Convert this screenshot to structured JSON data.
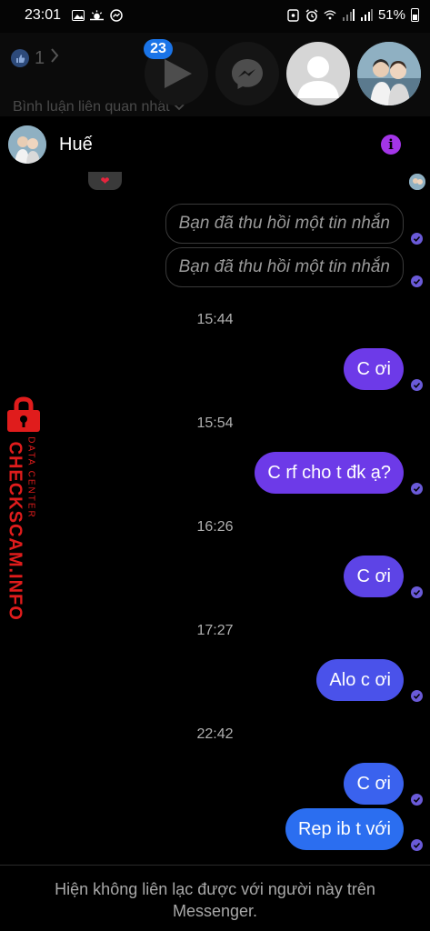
{
  "status_bar": {
    "time": "23:01",
    "battery": "51%",
    "icons": [
      "gallery-icon",
      "weather-icon",
      "messenger-icon",
      "lock-icon",
      "alarm-icon",
      "wifi-icon",
      "signal-icon",
      "signal-icon",
      "battery-icon"
    ]
  },
  "background": {
    "like_count": "1",
    "comments_label": "Bình luận liên quan nhất"
  },
  "chat_heads": {
    "badge": "23",
    "items": [
      "play-icon",
      "messenger-icon",
      "default-avatar",
      "contact-photo"
    ]
  },
  "chat": {
    "contact_name": "Huế",
    "reaction": "❤",
    "recalled": [
      "Bạn đã thu hồi một tin nhắn",
      "Bạn đã thu hồi một tin nhắn"
    ],
    "timestamps": [
      "15:44",
      "15:54",
      "16:26",
      "17:27",
      "22:42"
    ],
    "messages": [
      "C ơi",
      "C rf cho t đk ạ?",
      "C ơi",
      "Alo c ơi",
      "C ơi",
      "Rep ib t với"
    ],
    "footer": "Hiện không liên lạc được với người này trên Messenger."
  },
  "watermark": {
    "brand": "CHECKSCAM.INFO",
    "sub": "DATA CENTER"
  },
  "colors": {
    "bubble_purple": "#6d3ae8",
    "bubble_blue": "#2b6ef0",
    "accent": "#a335e8",
    "badge_blue": "#1a74e8",
    "watermark_red": "#e01c1c"
  }
}
